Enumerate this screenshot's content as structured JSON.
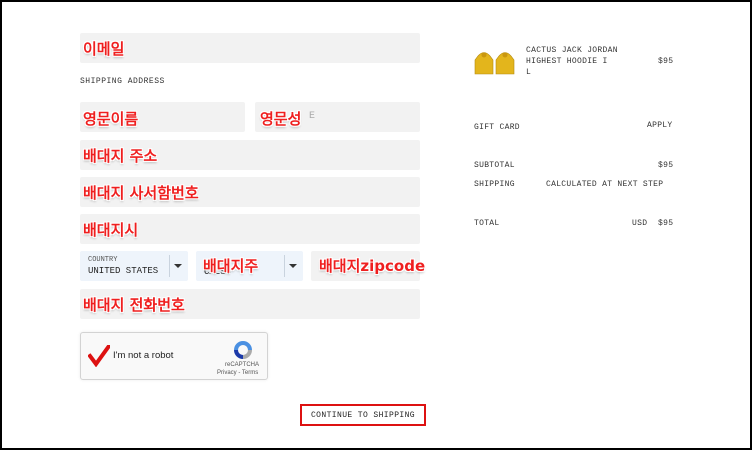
{
  "form": {
    "email_overlay": "이메일",
    "shipping_heading": "SHIPPING ADDRESS",
    "first_name_overlay": "영문이름",
    "last_name_overlay": "영문성",
    "last_name_placeholder": "E",
    "address_overlay": "배대지 주소",
    "suite_overlay": "배대지 사서함번호",
    "city_overlay": "배대지시",
    "country_caption": "COUNTRY",
    "country_value": "UNITED STATES",
    "state_overlay": "배대지주",
    "state_value": "CALSO",
    "zip_overlay": "배대지zipcode",
    "phone_overlay": "배대지 전화번호",
    "continue_label": "CONTINUE TO SHIPPING"
  },
  "recaptcha": {
    "label": "I'm not a robot",
    "brand": "reCAPTCHA",
    "links": "Privacy - Terms",
    "checked": true
  },
  "summary": {
    "product_name": "CACTUS JACK JORDAN HIGHEST HOODIE I L",
    "product_name_line1": "CACTUS JACK JORDAN",
    "product_name_line2": "HIGHEST HOODIE I",
    "product_name_line3": "L",
    "product_price": "$95",
    "gift_card_label": "GIFT CARD",
    "apply_label": "APPLY",
    "subtotal_label": "SUBTOTAL",
    "subtotal_value": "$95",
    "shipping_label": "SHIPPING",
    "shipping_value": "CALCULATED AT NEXT STEP",
    "total_label": "TOTAL",
    "total_currency": "USD",
    "total_value": "$95"
  },
  "colors": {
    "accent": "#d11111",
    "overlay_text": "#ef1f1f",
    "hoodie": "#e3b51c"
  }
}
